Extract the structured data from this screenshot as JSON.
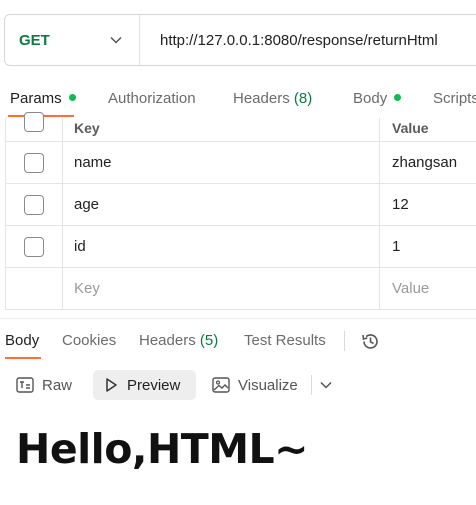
{
  "request": {
    "method": "GET",
    "url": "http://127.0.0.1:8080/response/returnHtml"
  },
  "request_tabs": {
    "params": "Params",
    "authorization": "Authorization",
    "headers": "Headers",
    "headers_count": "(8)",
    "body": "Body",
    "scripts": "Scripts"
  },
  "params_table": {
    "columns": {
      "key": "Key",
      "value": "Value"
    },
    "rows": [
      {
        "key": "name",
        "value": "zhangsan"
      },
      {
        "key": "age",
        "value": "12"
      },
      {
        "key": "id",
        "value": "1"
      }
    ],
    "placeholder_key": "Key",
    "placeholder_value": "Value"
  },
  "response_tabs": {
    "body": "Body",
    "cookies": "Cookies",
    "headers": "Headers",
    "headers_count": "(5)",
    "test_results": "Test Results"
  },
  "view_modes": {
    "raw": "Raw",
    "preview": "Preview",
    "visualize": "Visualize"
  },
  "preview": {
    "content": "Hello,HTML~"
  },
  "colors": {
    "method": "#0b7a43",
    "active_underline": "#ff6c37",
    "dot": "#0cbb52"
  },
  "icons": [
    "chevron-down-icon",
    "history-icon",
    "raw-icon",
    "play-icon",
    "image-icon"
  ]
}
